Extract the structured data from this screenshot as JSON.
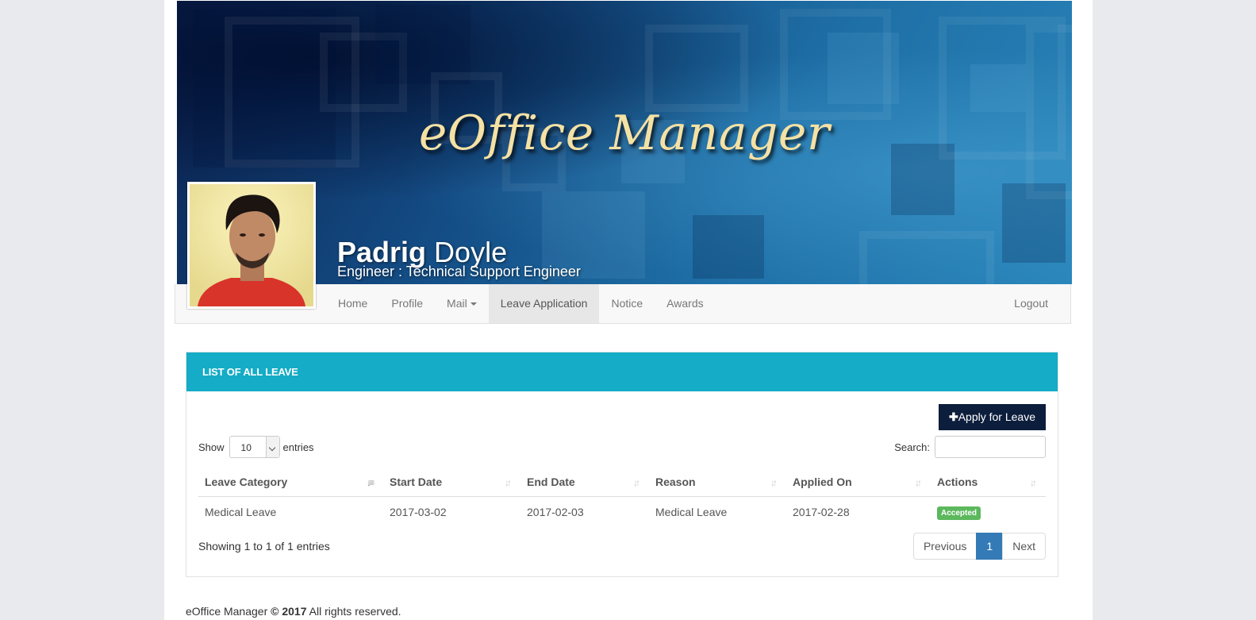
{
  "banner": {
    "title": "eOffice Manager",
    "first_name": "Padrig",
    "last_name": "Doyle",
    "designation": "Engineer : Technical Support Engineer"
  },
  "nav": {
    "items": [
      {
        "label": "Home"
      },
      {
        "label": "Profile"
      },
      {
        "label": "Mail"
      },
      {
        "label": "Leave Application"
      },
      {
        "label": "Notice"
      },
      {
        "label": "Awards"
      }
    ],
    "active": "Leave Application",
    "logout": "Logout"
  },
  "panel": {
    "heading": "LIST OF ALL LEAVE",
    "apply_label": "Apply for Leave",
    "show_label": "Show",
    "entries_label": "entries",
    "page_length": "10",
    "search_label": "Search:",
    "columns": [
      "Leave Category",
      "Start Date",
      "End Date",
      "Reason",
      "Applied On",
      "Actions"
    ],
    "rows": [
      {
        "category": "Medical Leave",
        "start": "2017-03-02",
        "end": "2017-02-03",
        "reason": "Medical Leave",
        "applied": "2017-02-28",
        "status": "Accepted"
      }
    ],
    "info": "Showing 1 to 1 of 1 entries",
    "pagination": {
      "previous": "Previous",
      "current": "1",
      "next": "Next"
    }
  },
  "footer": {
    "brand": "eOffice Manager",
    "year": "© 2017",
    "rights": "All rights reserved."
  },
  "colors": {
    "panel_header": "#14acc6",
    "apply_button": "#0c1e3c",
    "accepted_badge": "#5cb85c",
    "pagination_active": "#337ab7",
    "banner_title": "#f4e1a4"
  }
}
